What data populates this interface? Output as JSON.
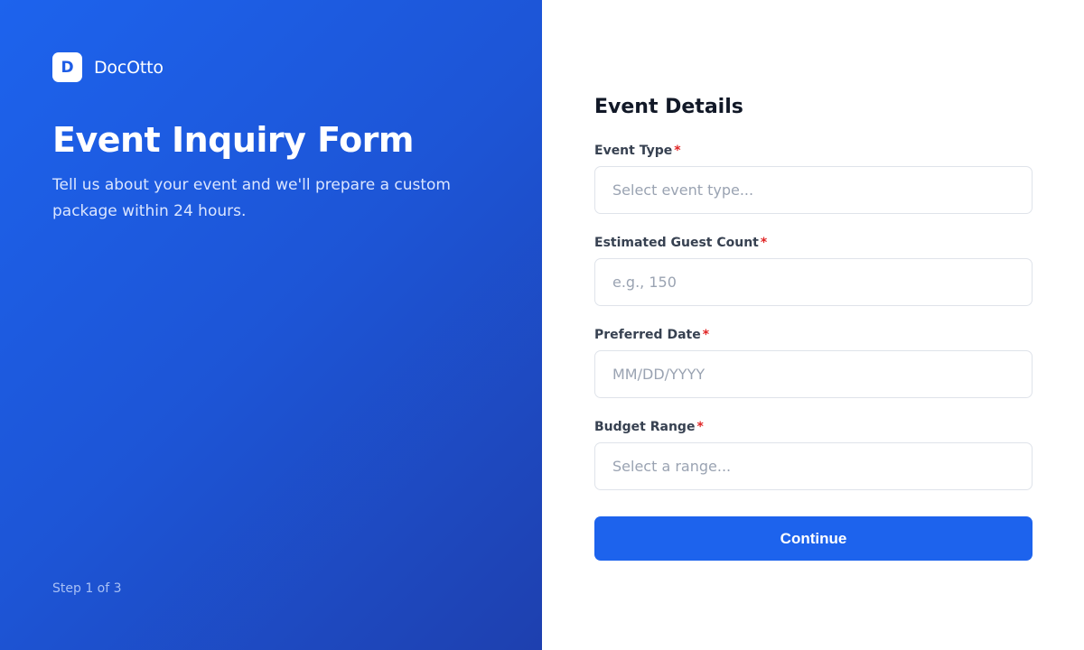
{
  "brand": {
    "logo_letter": "D",
    "name": "DocOtto"
  },
  "hero": {
    "title": "Event Inquiry Form",
    "subtitle": "Tell us about your event and we'll prepare a custom package within 24 hours."
  },
  "progress": {
    "step_text": "Step 1 of 3"
  },
  "form": {
    "title": "Event Details",
    "required_marker": "*",
    "fields": [
      {
        "label": "Event Type",
        "placeholder": "Select event type...",
        "type": "select",
        "value": ""
      },
      {
        "label": "Estimated Guest Count",
        "placeholder": "e.g., 150",
        "type": "number",
        "value": ""
      },
      {
        "label": "Preferred Date",
        "placeholder": "MM/DD/YYYY",
        "type": "text",
        "value": ""
      },
      {
        "label": "Budget Range",
        "placeholder": "Select a range...",
        "type": "select",
        "value": ""
      }
    ],
    "submit_label": "Continue"
  },
  "colors": {
    "primary": "#1d63ed",
    "gradient_end": "#1e40af",
    "required": "#e02424",
    "text_dark": "#111827"
  }
}
